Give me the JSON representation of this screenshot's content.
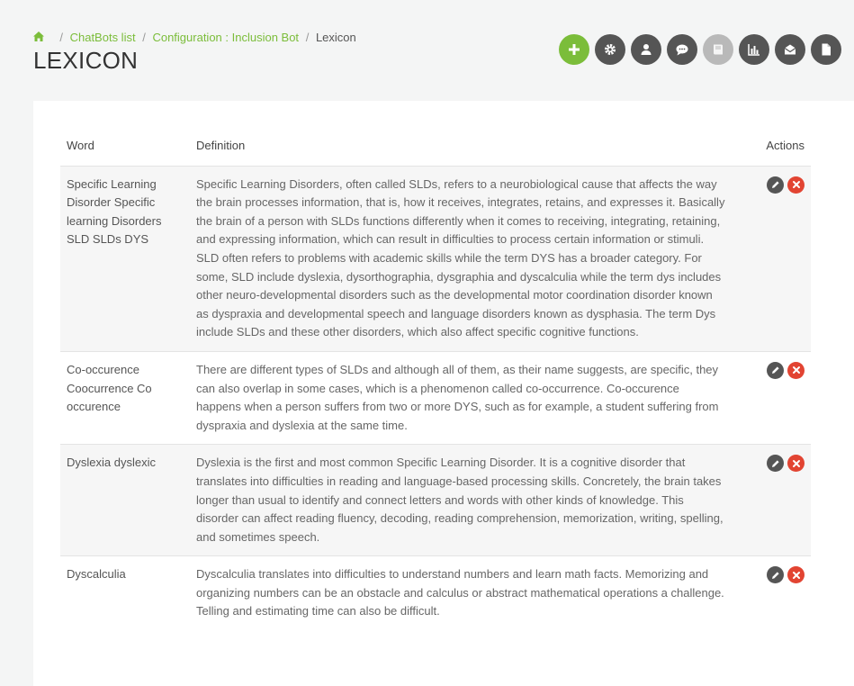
{
  "breadcrumb": {
    "items": [
      {
        "label": "ChatBots list"
      },
      {
        "label": "Configuration : Inclusion Bot"
      },
      {
        "label": "Lexicon"
      }
    ]
  },
  "page": {
    "title": "LEXICON"
  },
  "toolbar": {
    "buttons": [
      {
        "icon": "plus-icon",
        "color": "#7bbd3a"
      },
      {
        "icon": "gear-icon"
      },
      {
        "icon": "user-icon"
      },
      {
        "icon": "chat-bubble-icon"
      },
      {
        "icon": "book-icon",
        "disabled": true
      },
      {
        "icon": "bar-chart-icon"
      },
      {
        "icon": "envelope-open-icon"
      },
      {
        "icon": "file-icon"
      }
    ]
  },
  "table": {
    "headers": {
      "word": "Word",
      "definition": "Definition",
      "actions": "Actions"
    },
    "rows": [
      {
        "word": "Specific Learning Disorder Specific learning Disorders SLD SLDs DYS",
        "definition": "Specific Learning Disorders, often called SLDs, refers to a neurobiological cause that affects the way the brain processes information, that is, how it receives, integrates, retains, and expresses it. Basically the brain of a person with SLDs functions differently when it comes to receiving, integrating, retaining, and expressing information, which can result in difficulties to process certain information or stimuli. SLD often refers to problems with academic skills while the term DYS has a broader category. For some, SLD include dyslexia, dysorthographia, dysgraphia and dyscalculia while the term dys includes other neuro-developmental disorders such as the developmental motor coordination disorder known as dyspraxia and developmental speech and language disorders known as dysphasia. The term Dys include SLDs and these other disorders, which also affect specific cognitive functions."
      },
      {
        "word": "Co-occurence Coocurrence Co occurence",
        "definition": "There are different types of SLDs and although all of them, as their name suggests, are specific, they can also overlap in some cases, which is a phenomenon called co-occurrence. Co-occurence happens when a person suffers from two or more DYS, such as for example, a student suffering from dyspraxia and dyslexia at the same time."
      },
      {
        "word": "Dyslexia dyslexic",
        "definition": "Dyslexia is the first and most common Specific Learning Disorder. It is a cognitive disorder that translates into difficulties in reading and language-based processing skills. Concretely, the brain takes longer than usual to identify and connect letters and words with other kinds of knowledge. This disorder can affect reading fluency, decoding, reading comprehension, memorization, writing, spelling, and sometimes speech."
      },
      {
        "word": "Dyscalculia",
        "definition": "Dyscalculia translates into difficulties to understand numbers and learn math facts. Memorizing and organizing numbers can be an obstacle and calculus or abstract mathematical operations a challenge. Telling and estimating time can also be difficult."
      }
    ]
  }
}
